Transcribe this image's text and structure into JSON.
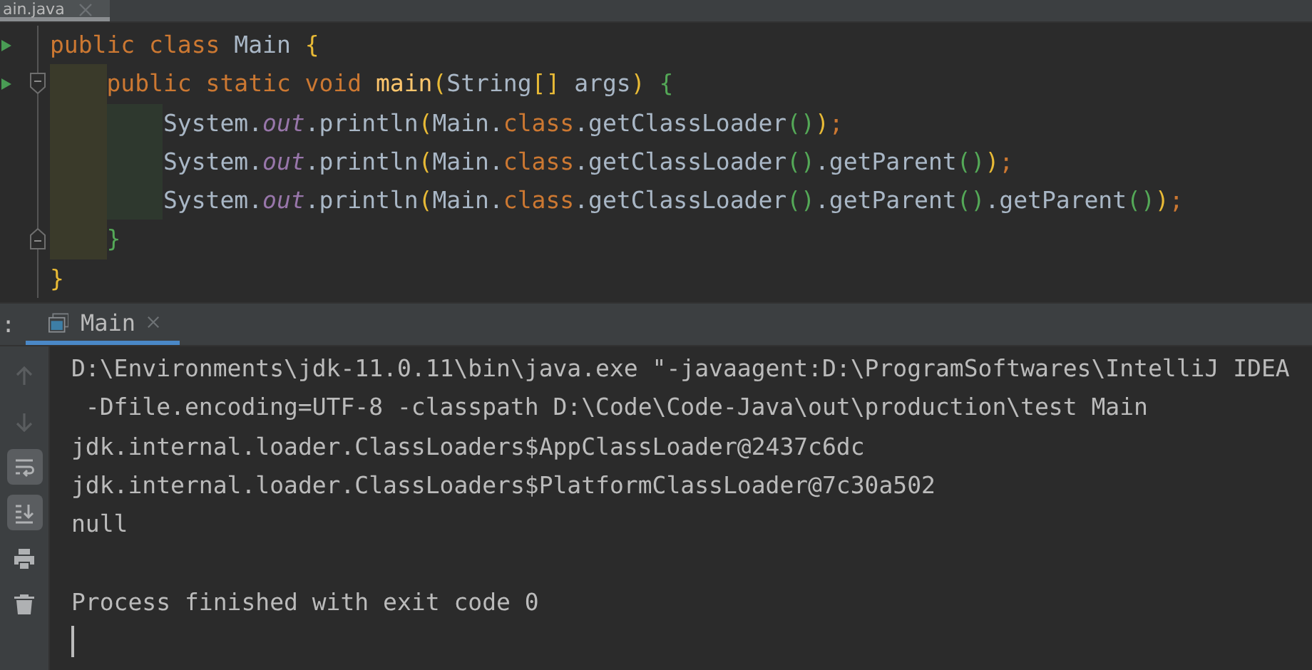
{
  "editor": {
    "tab": {
      "label": "ain.java",
      "selected": true
    },
    "lines": [
      {
        "runnable": true,
        "fold_start": false,
        "fold_end": false,
        "tokens": [
          {
            "kind": "keyword",
            "text": "public class "
          },
          {
            "kind": "plain",
            "text": "Main "
          },
          {
            "kind": "brace1",
            "text": "{"
          }
        ]
      },
      {
        "runnable": true,
        "fold_start": true,
        "fold_end": false,
        "guides": [
          {
            "color": "#3a3a2a"
          }
        ],
        "tokens": [
          {
            "kind": "keyword",
            "text": "public static void "
          },
          {
            "kind": "method",
            "text": "main"
          },
          {
            "kind": "brace1",
            "text": "("
          },
          {
            "kind": "plain",
            "text": "String"
          },
          {
            "kind": "brace1",
            "text": "[]"
          },
          {
            "kind": "plain",
            "text": " args"
          },
          {
            "kind": "brace1",
            "text": ") "
          },
          {
            "kind": "brace2",
            "text": "{"
          }
        ]
      },
      {
        "runnable": false,
        "guides": [
          {
            "color": "#3a3a2a"
          },
          {
            "color": "#2e382e"
          }
        ],
        "tokens": [
          {
            "kind": "plain",
            "text": "System."
          },
          {
            "kind": "field",
            "text": "out"
          },
          {
            "kind": "plain",
            "text": ".println"
          },
          {
            "kind": "brace1",
            "text": "("
          },
          {
            "kind": "plain",
            "text": "Main."
          },
          {
            "kind": "keyword",
            "text": "class"
          },
          {
            "kind": "plain",
            "text": ".getClassLoader"
          },
          {
            "kind": "brace2",
            "text": "()"
          },
          {
            "kind": "brace1",
            "text": ")"
          },
          {
            "kind": "punct",
            "text": ";"
          }
        ]
      },
      {
        "runnable": false,
        "guides": [
          {
            "color": "#3a3a2a"
          },
          {
            "color": "#2e382e"
          }
        ],
        "tokens": [
          {
            "kind": "plain",
            "text": "System."
          },
          {
            "kind": "field",
            "text": "out"
          },
          {
            "kind": "plain",
            "text": ".println"
          },
          {
            "kind": "brace1",
            "text": "("
          },
          {
            "kind": "plain",
            "text": "Main."
          },
          {
            "kind": "keyword",
            "text": "class"
          },
          {
            "kind": "plain",
            "text": ".getClassLoader"
          },
          {
            "kind": "brace2",
            "text": "()"
          },
          {
            "kind": "plain",
            "text": ".getParent"
          },
          {
            "kind": "brace2",
            "text": "()"
          },
          {
            "kind": "brace1",
            "text": ")"
          },
          {
            "kind": "punct",
            "text": ";"
          }
        ]
      },
      {
        "runnable": false,
        "guides": [
          {
            "color": "#3a3a2a"
          },
          {
            "color": "#2e382e"
          }
        ],
        "tokens": [
          {
            "kind": "plain",
            "text": "System."
          },
          {
            "kind": "field",
            "text": "out"
          },
          {
            "kind": "plain",
            "text": ".println"
          },
          {
            "kind": "brace1",
            "text": "("
          },
          {
            "kind": "plain",
            "text": "Main."
          },
          {
            "kind": "keyword",
            "text": "class"
          },
          {
            "kind": "plain",
            "text": ".getClassLoader"
          },
          {
            "kind": "brace2",
            "text": "()"
          },
          {
            "kind": "plain",
            "text": ".getParent"
          },
          {
            "kind": "brace2",
            "text": "()"
          },
          {
            "kind": "plain",
            "text": ".getParent"
          },
          {
            "kind": "brace2",
            "text": "()"
          },
          {
            "kind": "brace1",
            "text": ")"
          },
          {
            "kind": "punct",
            "text": ";"
          }
        ]
      },
      {
        "runnable": false,
        "fold_start": false,
        "fold_end": true,
        "guides": [
          {
            "color": "#3a3a2a"
          }
        ],
        "tokens": [
          {
            "kind": "brace2",
            "text": "}"
          }
        ]
      },
      {
        "runnable": false,
        "fold_start": false,
        "fold_end": false,
        "tokens": [
          {
            "kind": "brace1",
            "text": "}"
          }
        ]
      }
    ]
  },
  "run_panel": {
    "label": ":",
    "tab": {
      "label": "Main",
      "selected": true
    },
    "toolbar": [
      {
        "kind": "up",
        "disabled": true,
        "selected": false
      },
      {
        "kind": "down",
        "disabled": true,
        "selected": false
      },
      {
        "kind": "wrap",
        "disabled": false,
        "selected": true
      },
      {
        "kind": "scroll-end",
        "disabled": false,
        "selected": true
      },
      {
        "kind": "print",
        "disabled": false,
        "selected": false
      },
      {
        "kind": "trash",
        "disabled": false,
        "selected": false
      }
    ],
    "console": {
      "cursor": true,
      "lines": [
        {
          "kind": "command",
          "text": "D:\\Environments\\jdk-11.0.11\\bin\\java.exe \"-javaagent:D:\\ProgramSoftwares\\IntelliJ IDEA"
        },
        {
          "kind": "continuation",
          "text": "-Dfile.encoding=UTF-8 -classpath D:\\Code\\Code-Java\\out\\production\\test Main"
        },
        {
          "kind": "output",
          "text": "jdk.internal.loader.ClassLoaders$AppClassLoader@2437c6dc"
        },
        {
          "kind": "output",
          "text": "jdk.internal.loader.ClassLoaders$PlatformClassLoader@7c30a502"
        },
        {
          "kind": "output",
          "text": "null"
        },
        {
          "kind": "blank"
        },
        {
          "kind": "output",
          "text": "Process finished with exit code 0"
        }
      ]
    }
  }
}
